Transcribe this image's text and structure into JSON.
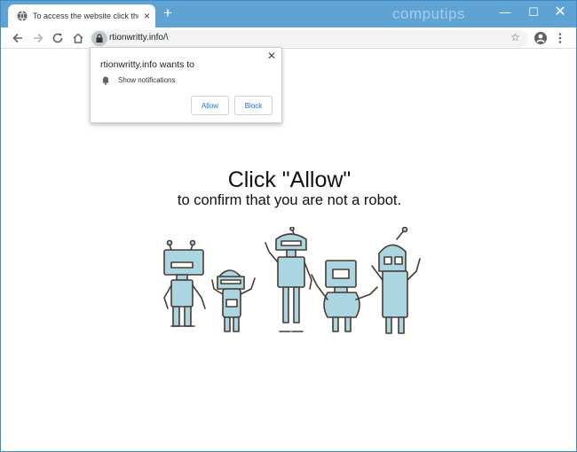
{
  "browser": {
    "tab_title": "To access the website click the \"A",
    "url": "rtionwritty.info/\\",
    "watermark": "computips"
  },
  "popup": {
    "title": "rtionwritty.info wants to",
    "notification_text": "Show notifications",
    "allow_label": "Allow",
    "block_label": "Block"
  },
  "page": {
    "headline": "Click \"Allow\"",
    "subline": "to confirm that you are not a robot."
  },
  "colors": {
    "titlebar": "#5fa3d4",
    "link_blue": "#1a6fd0",
    "robot_fill": "#a9d6e0",
    "robot_outline": "#4b3a33"
  },
  "icons": {
    "favicon": "globe-icon",
    "back": "arrow-left-icon",
    "forward": "arrow-right-icon",
    "reload": "reload-icon",
    "home": "home-icon",
    "lock": "lock-icon",
    "bookmark": "star-icon",
    "profile": "account-circle-icon",
    "menu": "more-vert-icon",
    "bell": "bell-icon"
  }
}
